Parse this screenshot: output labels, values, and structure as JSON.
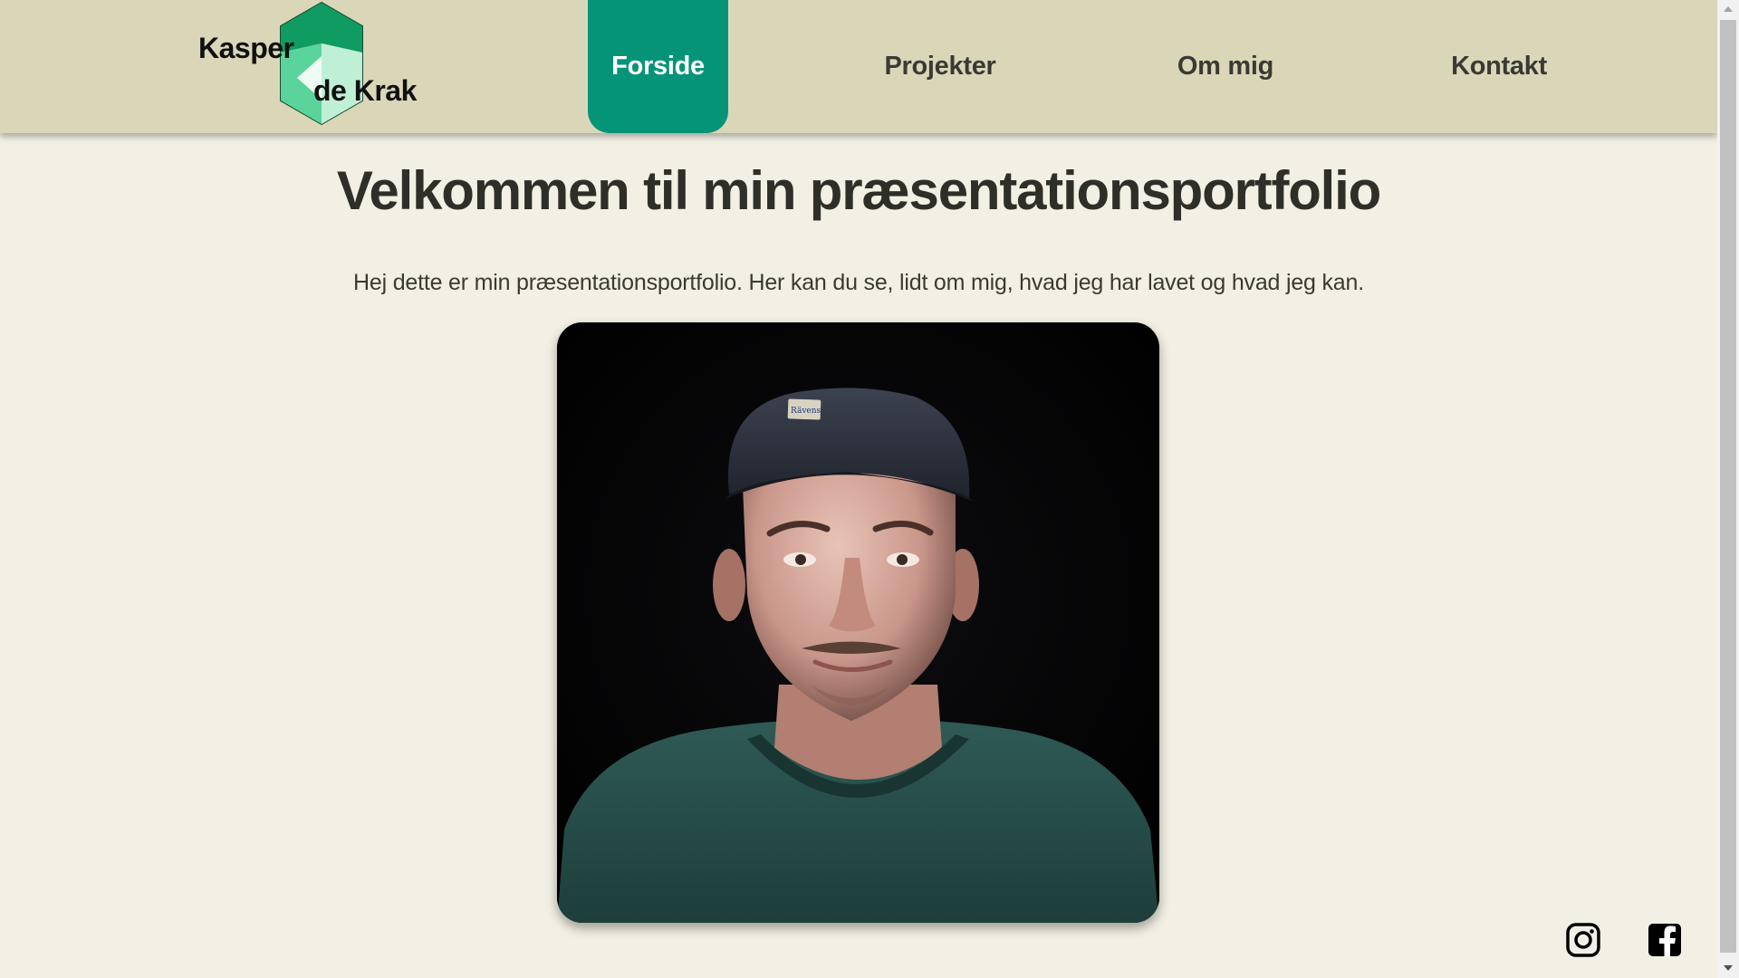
{
  "logo": {
    "line1": "Kasper",
    "line2": "de Krak",
    "colors": [
      "#0f9b61",
      "#5ad49a",
      "#bff0d6",
      "#eefcf3"
    ]
  },
  "nav": {
    "items": [
      {
        "label": "Forside",
        "active": true
      },
      {
        "label": "Projekter",
        "active": false
      },
      {
        "label": "Om mig",
        "active": false
      },
      {
        "label": "Kontakt",
        "active": false
      }
    ],
    "active_color": "#069479",
    "bar_color": "#d9d7b8"
  },
  "main": {
    "title": "Velkommen til min præsentationsportfolio",
    "intro": "Hej dette er min præsentationsportfolio. Her kan du se, lidt om mig, hvad jeg har lavet og hvad jeg kan.",
    "portrait_icon": "person-portrait-photo",
    "cap_badge": "Rävens SPORT"
  },
  "social": [
    {
      "icon": "instagram-icon"
    },
    {
      "icon": "facebook-icon"
    }
  ],
  "page_background": "#f2f0e4"
}
